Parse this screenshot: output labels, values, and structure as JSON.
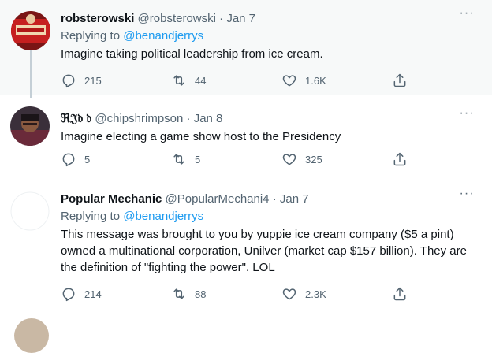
{
  "tweets": [
    {
      "name": "robsterowski",
      "handle": "@robsterowski",
      "dot": "·",
      "date": "Jan 7",
      "reply_prefix": "Replying to",
      "reply_to": "@benandjerrys",
      "text": "Imagine taking political leadership from ice cream.",
      "replies": "215",
      "retweets": "44",
      "likes": "1.6K",
      "more": "···"
    },
    {
      "name": "ℜ𝔍𝔡 𝔡",
      "handle": "@chipshrimpson",
      "dot": "·",
      "date": "Jan 8",
      "text": "Imagine electing a game show host to the Presidency",
      "replies": "5",
      "retweets": "5",
      "likes": "325",
      "more": "···"
    },
    {
      "name": "Popular Mechanic",
      "handle": "@PopularMechani4",
      "dot": "·",
      "date": "Jan 7",
      "reply_prefix": "Replying to",
      "reply_to": "@benandjerrys",
      "text": "This message was brought to you by yuppie ice cream company ($5 a pint) owned a multinational corporation, Unilver (market cap $157 billion).  They are the definition of \"fighting the power\".  LOL",
      "replies": "214",
      "retweets": "88",
      "likes": "2.3K",
      "more": "···"
    }
  ],
  "colors": {
    "accent": "#1d9bf0",
    "secondary_text": "#536471",
    "highlight_bg": "#f7f9f9"
  }
}
